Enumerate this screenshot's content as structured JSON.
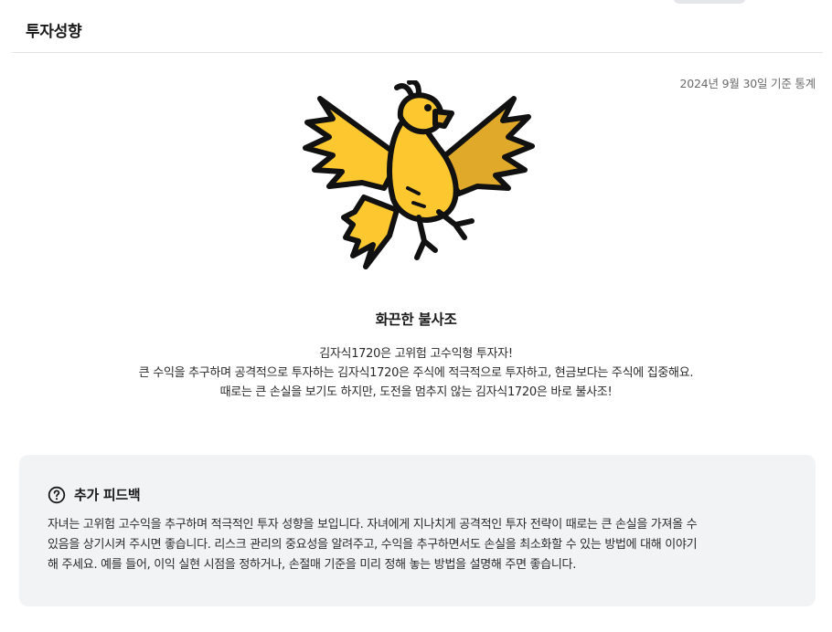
{
  "header": {
    "title": "투자성향"
  },
  "stats": {
    "date_label": "2024년 9월 30일 기준 통계"
  },
  "result": {
    "illustration_icon": "phoenix-bird-icon",
    "type_name": "화끈한 불사조",
    "description_lines": [
      "김자식1720은 고위험 고수익형 투자자!",
      "큰 수익을 추구하며 공격적으로 투자하는 김자식1720은 주식에 적극적으로 투자하고, 현금보다는 주식에 집중해요.",
      "때로는 큰 손실을 보기도 하지만, 도전을 멈추지 않는 김자식1720은 바로 불사조!"
    ]
  },
  "feedback": {
    "icon": "question-circle-icon",
    "title": "추가 피드백",
    "text_lines": [
      "자녀는 고위험 고수익을 추구하며 적극적인 투자 성향을 보입니다. 자녀에게 지나치게 공격적인 투자 전략이 때로는 큰 손실을 가져올 수",
      "있음을 상기시켜 주시면 좋습니다. 리스크 관리의 중요성을 알려주고, 수익을 추구하면서도 손실을 최소화할 수 있는 방법에 대해 이야기",
      "해 주세요. 예를 들어, 이익 실현 시점을 정하거나, 손절매 기준을 미리 정해 놓는 방법을 설명해 주면 좋습니다."
    ]
  },
  "colors": {
    "bird_yellow": "#FDC730",
    "bird_wing_dark": "#E0A92A",
    "outline": "#111111",
    "feedback_bg": "#F2F3F5",
    "divider": "#E3E3E3"
  }
}
